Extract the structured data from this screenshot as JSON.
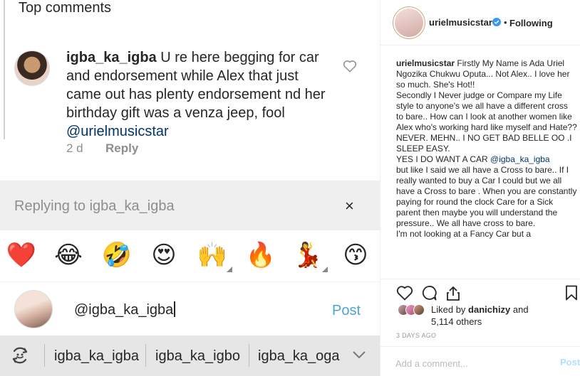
{
  "mobile": {
    "top_comments_label": "Top comments",
    "comment": {
      "username": "igba_ka_igba",
      "text": " U re here begging for car and endorsement while Alex that just came out has plenty endorsement nd her birthday gift was a venza jeep, fool ",
      "mention": "@urielmusicstar",
      "age": "2 d",
      "reply_label": "Reply"
    },
    "replying_to": "Replying to igba_ka_igba",
    "close_icon": "×",
    "emojis": [
      "❤️",
      "😂",
      "🤣",
      "😍",
      "🙌",
      "🔥",
      "💃",
      "😙"
    ],
    "compose_value": "@igba_ka_igba",
    "post_label": "Post",
    "suggestions": [
      "igba_ka_igba",
      "igba_ka_igbo",
      "igba_ka_oga"
    ],
    "colors": {
      "link": "#003569",
      "post": "#4fa3d8",
      "muted": "#8e8e8e"
    }
  },
  "desktop": {
    "username": "urielmusicstar",
    "dot": "•",
    "following_label": "Following",
    "caption_user": "urielmusicstar",
    "caption_part1": " Firstly My Name is Ada Uriel Ngozika Chukwu Oputa... Not Alex.. I love her so much. She's Hot!!\nSecondly I Never judge or Compare my Life style to anyone's we all have a different cross to bare.. How can I look at another women like Alex who's working hard like myself and Hate??\nNEVER. MEHN.. I NO GET BAD BELLE OO .I SLEEP EASY.\nYES I DO WANT A CAR ",
    "caption_mention": "@igba_ka_igba",
    "caption_part2": "\nbut like I said we all have a Cross to bare.. If I really wanted to buy a Car I could but we all have a Cross to bare . When you are constantly paying for round the clock Care for a Sick parent then maybe you will understand the pressure.. We all have cross to bare.\nI'm not looking at a Fancy Car but a",
    "likes_prefix": "Liked by ",
    "likes_user": "danichizy",
    "likes_and": " and",
    "likes_others": "5,114 others",
    "timestamp": "3 DAYS AGO",
    "add_comment_placeholder": "Add a comment...",
    "post_label": "Post",
    "colors": {
      "verified": "#3897f0",
      "post_disabled": "#b2dffc"
    }
  }
}
